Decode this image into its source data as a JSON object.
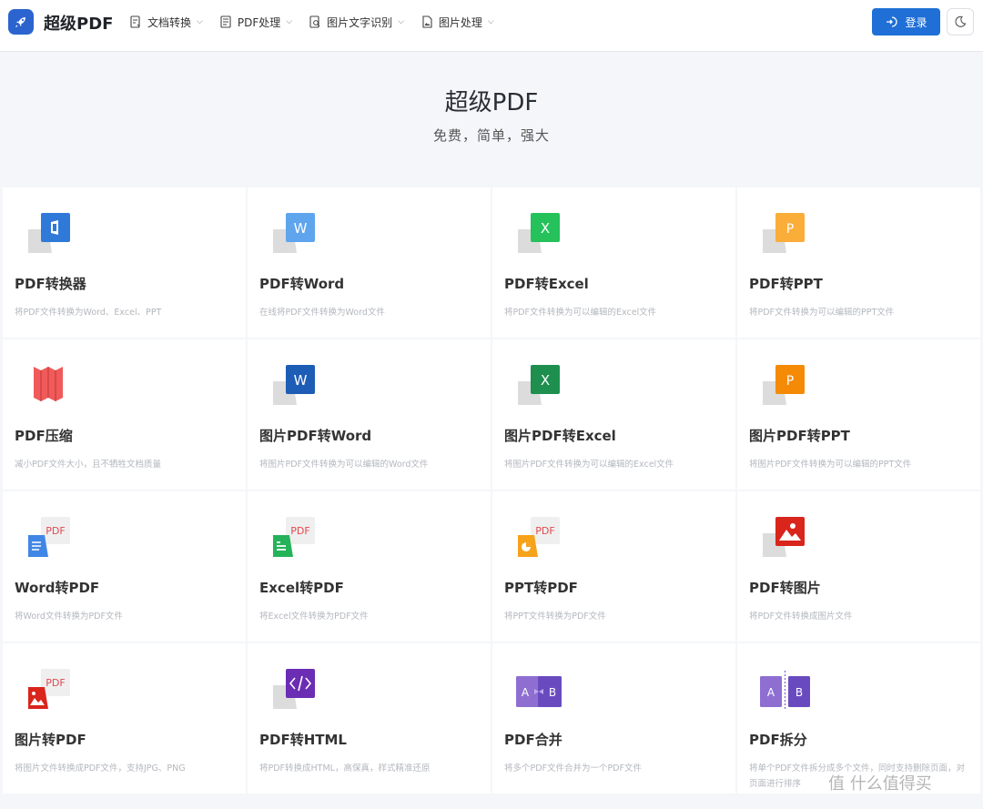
{
  "brand": "超级PDF",
  "colors": {
    "primary": "#1f6fd6",
    "logo_bg": "#2b64cf"
  },
  "nav": [
    {
      "label": "文档转换",
      "icon": "doc-convert-icon"
    },
    {
      "label": "PDF处理",
      "icon": "pdf-doc-icon"
    },
    {
      "label": "图片文字识别",
      "icon": "ocr-icon"
    },
    {
      "label": "图片处理",
      "icon": "image-doc-icon"
    }
  ],
  "login": {
    "label": "登录"
  },
  "hero": {
    "title": "超级PDF",
    "subtitle": "免费，简单，强大"
  },
  "cards": [
    {
      "title": "PDF转换器",
      "desc": "将PDF文件转换为Word、Excel、PPT",
      "icon": "office-icon"
    },
    {
      "title": "PDF转Word",
      "desc": "在线将PDF文件转换为Word文件",
      "icon": "word-icon"
    },
    {
      "title": "PDF转Excel",
      "desc": "将PDF文件转换为可以编辑的Excel文件",
      "icon": "excel-icon"
    },
    {
      "title": "PDF转PPT",
      "desc": "将PDF文件转换为可以编辑的PPT文件",
      "icon": "ppt-icon"
    },
    {
      "title": "PDF压缩",
      "desc": "减小PDF文件大小，且不牺牲文档质量",
      "icon": "compress-icon"
    },
    {
      "title": "图片PDF转Word",
      "desc": "将图片PDF文件转换为可以编辑的Word文件",
      "icon": "word-icon"
    },
    {
      "title": "图片PDF转Excel",
      "desc": "将图片PDF文件转换为可以编辑的Excel文件",
      "icon": "excel-icon"
    },
    {
      "title": "图片PDF转PPT",
      "desc": "将图片PDF文件转换为可以编辑的PPT文件",
      "icon": "ppt-icon"
    },
    {
      "title": "Word转PDF",
      "desc": "将Word文件转换为PDF文件",
      "icon": "word-to-pdf-icon"
    },
    {
      "title": "Excel转PDF",
      "desc": "将Excel文件转换为PDF文件",
      "icon": "excel-to-pdf-icon"
    },
    {
      "title": "PPT转PDF",
      "desc": "将PPT文件转换为PDF文件",
      "icon": "ppt-to-pdf-icon"
    },
    {
      "title": "PDF转图片",
      "desc": "将PDF文件转换成图片文件",
      "icon": "pdf-to-image-icon"
    },
    {
      "title": "图片转PDF",
      "desc": "将图片文件转换成PDF文件，支持JPG、PNG",
      "icon": "image-to-pdf-icon"
    },
    {
      "title": "PDF转HTML",
      "desc": "将PDF转换成HTML，高保真，样式精准还原",
      "icon": "html-icon"
    },
    {
      "title": "PDF合并",
      "desc": "将多个PDF文件合并为一个PDF文件",
      "icon": "merge-icon"
    },
    {
      "title": "PDF拆分",
      "desc": "将单个PDF文件拆分成多个文件，同时支持删除页面，对页面进行排序",
      "icon": "split-icon"
    }
  ],
  "icon_text": {
    "word": "W",
    "excel": "X",
    "ppt": "P",
    "pdf": "PDF",
    "a": "A",
    "b": "B"
  },
  "watermark": "值 什么值得买"
}
